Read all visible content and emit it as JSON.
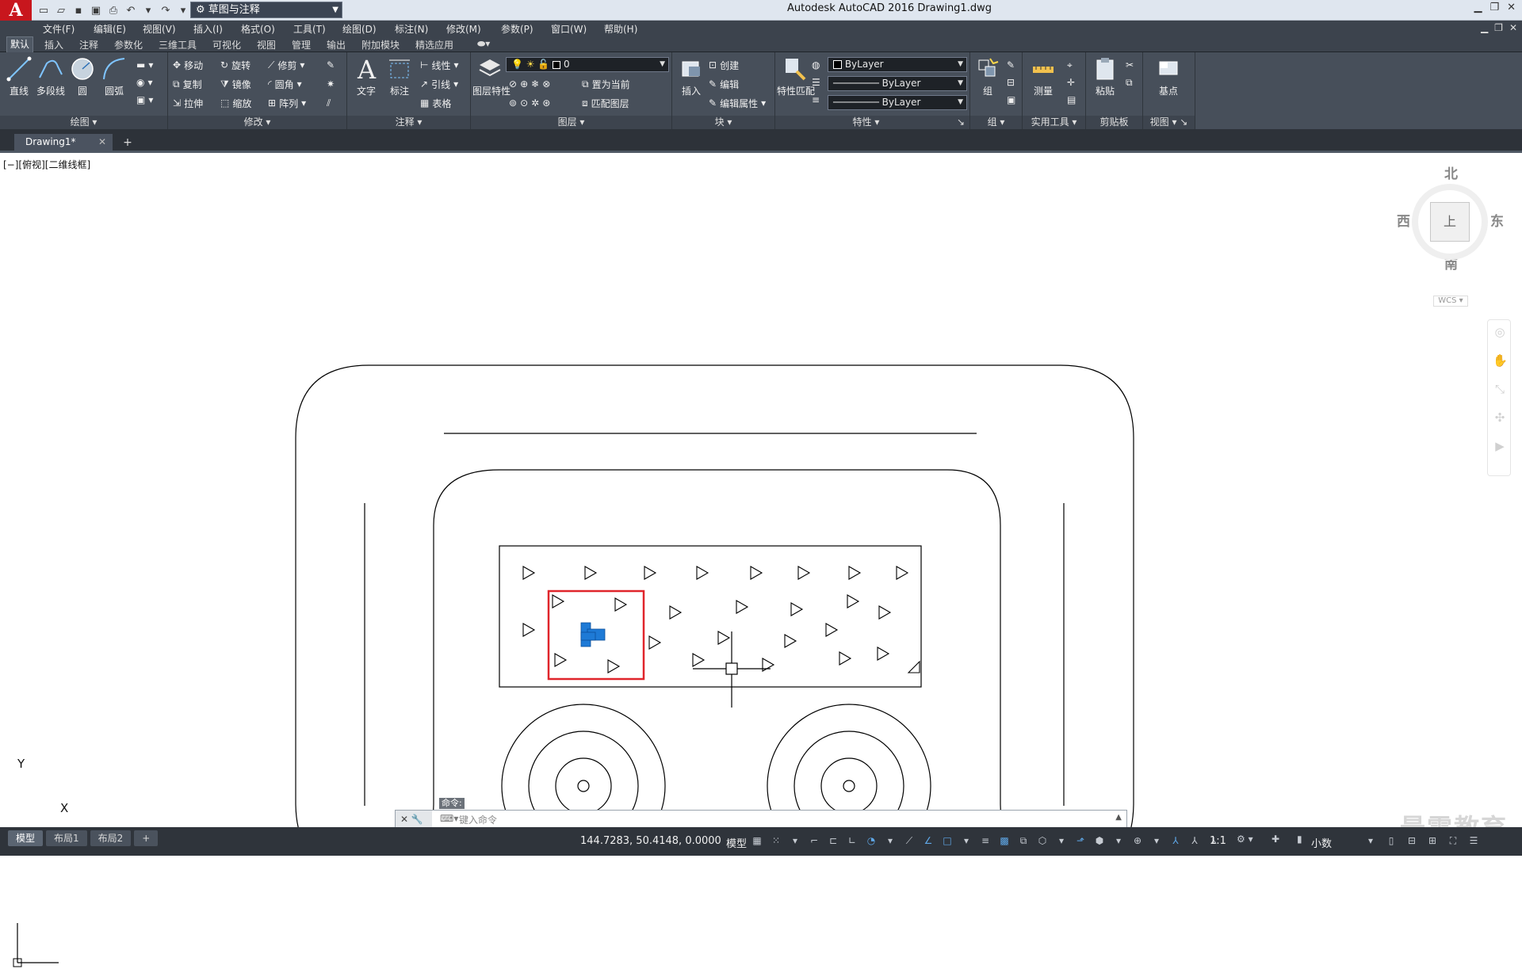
{
  "titlebar": {
    "title": "Autodesk AutoCAD 2016    Drawing1.dwg",
    "workspace": "草图与注释",
    "logo": "A"
  },
  "menubar": [
    "文件(F)",
    "编辑(E)",
    "视图(V)",
    "插入(I)",
    "格式(O)",
    "工具(T)",
    "绘图(D)",
    "标注(N)",
    "修改(M)",
    "参数(P)",
    "窗口(W)",
    "帮助(H)"
  ],
  "ribbon_tabs": [
    "默认",
    "插入",
    "注释",
    "参数化",
    "三维工具",
    "可视化",
    "视图",
    "管理",
    "输出",
    "附加模块",
    "精选应用"
  ],
  "ribbon": {
    "draw": {
      "title": "绘图",
      "line": "直线",
      "polyline": "多段线",
      "circle": "圆",
      "arc": "圆弧"
    },
    "modify": {
      "title": "修改",
      "move": "移动",
      "rotate": "旋转",
      "trim": "修剪",
      "copy": "复制",
      "mirror": "镜像",
      "fillet": "圆角",
      "stretch": "拉伸",
      "scale": "缩放",
      "array": "阵列"
    },
    "annotation": {
      "title": "注释",
      "text": "文字",
      "dimension": "标注",
      "linear": "线性",
      "leader": "引线",
      "table": "表格"
    },
    "layers": {
      "title": "图层",
      "layer_props": "图层特性",
      "current_layer": "0",
      "set_current": "置为当前",
      "match_layer": "匹配图层"
    },
    "block": {
      "title": "块",
      "insert": "插入",
      "create": "创建",
      "edit": "编辑",
      "edit_attr": "编辑属性"
    },
    "properties": {
      "title": "特性",
      "match_props": "特性匹配",
      "color": "ByLayer",
      "linetype": "ByLayer",
      "lineweight": "ByLayer"
    },
    "groups": {
      "title": "组",
      "group": "组"
    },
    "utilities": {
      "title": "实用工具",
      "measure": "测量"
    },
    "clipboard": {
      "title": "剪贴板",
      "paste": "粘贴"
    },
    "view": {
      "title": "视图",
      "base": "基点"
    }
  },
  "doc_tab": {
    "name": "Drawing1*"
  },
  "viewport": {
    "label": "[−][俯视][二维线框]"
  },
  "viewcube": {
    "north": "北",
    "south": "南",
    "east": "东",
    "west": "西",
    "wcs": "WCS",
    "top_face": "上"
  },
  "ucs": {
    "x": "X",
    "y": "Y"
  },
  "command": {
    "history_label": "命令:",
    "placeholder": "键入命令"
  },
  "status": {
    "layouts": [
      "模型",
      "布局1",
      "布局2"
    ],
    "coords": "144.7283, 50.4148, 0.0000",
    "space": "模型",
    "annoscale": "1:1",
    "units": "小数"
  },
  "watermark": "最需教育",
  "colors": {
    "accent": "#1e7ad6",
    "selection_box": "#e0252b",
    "ribbon_bg": "#474f5a",
    "titlebar_bg": "#dfe6ef"
  }
}
